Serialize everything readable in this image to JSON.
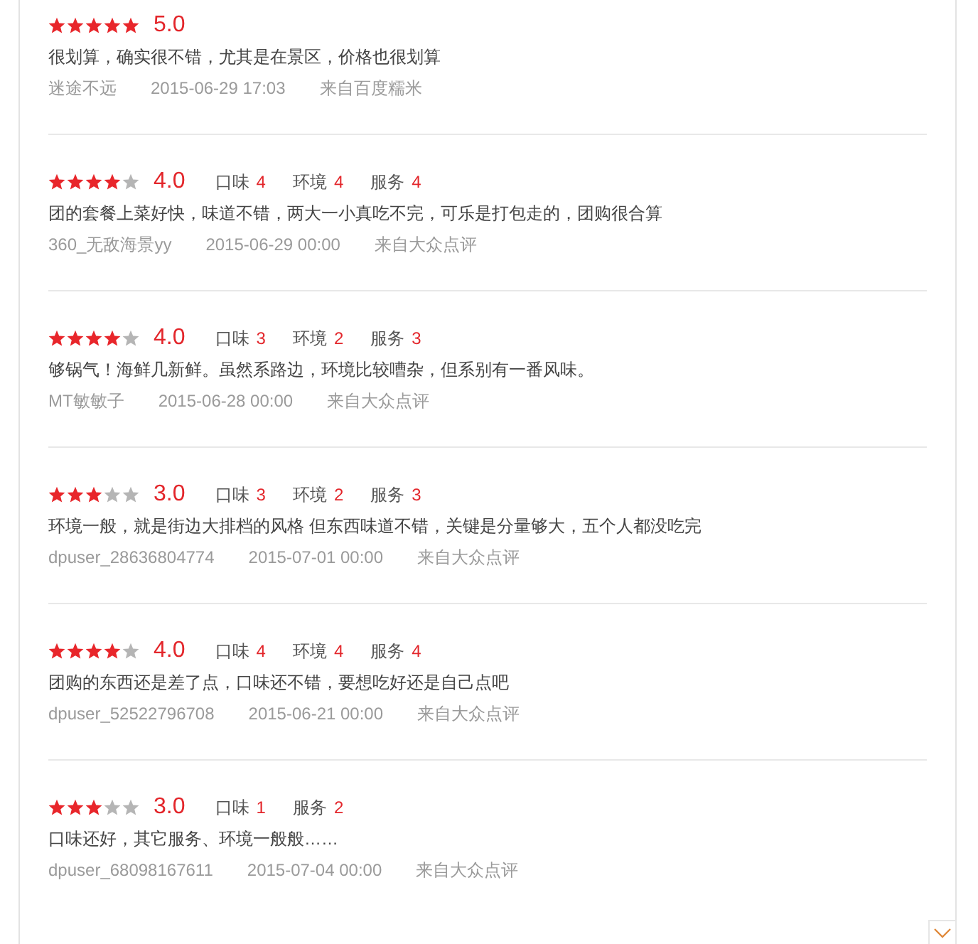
{
  "reviews": [
    {
      "stars": 5,
      "score": "5.0",
      "text": "很划算，确实很不错，尤其是在景区，价格也很划算",
      "author": "迷途不远",
      "time": "2015-06-29 17:03",
      "source": "来自百度糯米"
    },
    {
      "stars": 4,
      "score": "4.0",
      "aspects": [
        {
          "label": "口味",
          "value": "4"
        },
        {
          "label": "环境",
          "value": "4"
        },
        {
          "label": "服务",
          "value": "4"
        }
      ],
      "text": "团的套餐上菜好快，味道不错，两大一小真吃不完，可乐是打包走的，团购很合算",
      "author": "360_无敌海景yy",
      "time": "2015-06-29 00:00",
      "source": "来自大众点评"
    },
    {
      "stars": 4,
      "score": "4.0",
      "aspects": [
        {
          "label": "口味",
          "value": "3"
        },
        {
          "label": "环境",
          "value": "2"
        },
        {
          "label": "服务",
          "value": "3"
        }
      ],
      "text": "够锅气！海鲜几新鲜。虽然系路边，环境比较嘈杂，但系别有一番风味。",
      "author": "MT敏敏子",
      "time": "2015-06-28 00:00",
      "source": "来自大众点评"
    },
    {
      "stars": 3,
      "score": "3.0",
      "aspects": [
        {
          "label": "口味",
          "value": "3"
        },
        {
          "label": "环境",
          "value": "2"
        },
        {
          "label": "服务",
          "value": "3"
        }
      ],
      "text": "环境一般，就是街边大排档的风格 但东西味道不错，关键是分量够大，五个人都没吃完",
      "author": "dpuser_28636804774",
      "time": "2015-07-01 00:00",
      "source": "来自大众点评"
    },
    {
      "stars": 4,
      "score": "4.0",
      "aspects": [
        {
          "label": "口味",
          "value": "4"
        },
        {
          "label": "环境",
          "value": "4"
        },
        {
          "label": "服务",
          "value": "4"
        }
      ],
      "text": "团购的东西还是差了点，口味还不错，要想吃好还是自己点吧",
      "author": "dpuser_52522796708",
      "time": "2015-06-21 00:00",
      "source": "来自大众点评"
    },
    {
      "stars": 3,
      "score": "3.0",
      "aspects": [
        {
          "label": "口味",
          "value": "1"
        },
        {
          "label": "服务",
          "value": "2"
        }
      ],
      "text": "口味还好，其它服务、环境一般般……",
      "author": "dpuser_68098167611",
      "time": "2015-07-04 00:00",
      "source": "来自大众点评"
    }
  ]
}
